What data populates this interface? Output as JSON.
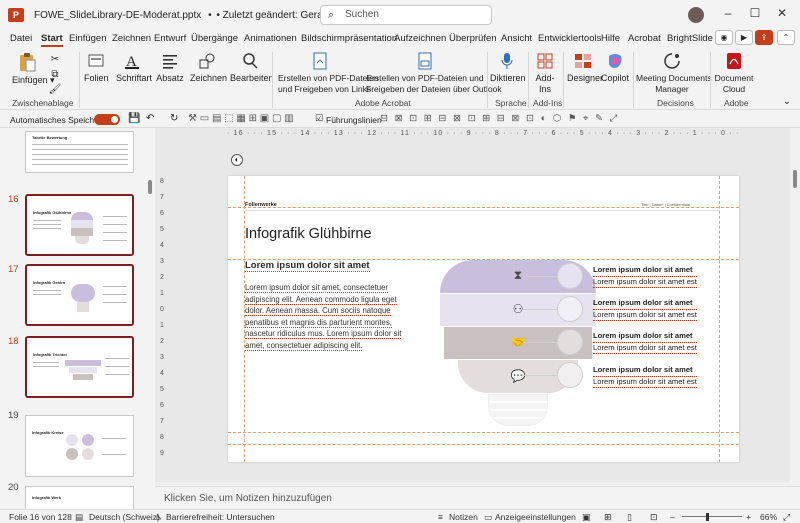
{
  "titlebar": {
    "app_badge": "P",
    "filename": "FOWE_SlideLibrary-DE-Moderat.pptx",
    "saved_status": "• Zuletzt geändert: Gerade eben",
    "search_placeholder": "Suchen"
  },
  "menu": [
    "Datei",
    "Start",
    "Einfügen",
    "Zeichnen",
    "Entwurf",
    "Übergänge",
    "Animationen",
    "Bildschirmpräsentation",
    "Aufzeichnen",
    "Überprüfen",
    "Ansicht",
    "Entwicklertools",
    "Hilfe",
    "Acrobat",
    "BrightSlide"
  ],
  "menu_active": "Start",
  "ribbon": {
    "paste": "Einfügen",
    "clipboard_group": "Zwischenablage",
    "slides": "Folien",
    "font": "Schriftart",
    "paragraph": "Absatz",
    "drawing": "Zeichnen",
    "editing": "Bearbeiten",
    "pdf_share_1": "Erstellen von PDF-Dateien",
    "pdf_share_2": "und Freigeben von Links",
    "pdf_outlook_1": "Erstellen von PDF-Dateien und",
    "pdf_outlook_2": "Freigeben der Dateien über Outlook",
    "acrobat_group": "Adobe Acrobat",
    "dictate": "Diktieren",
    "speech_group": "Sprache",
    "addins_1": "Add-",
    "addins_2": "Ins",
    "addins_group": "Add-Ins",
    "designer": "Designer",
    "copilot": "Copilot",
    "meeting_1": "Meeting Documents",
    "meeting_2": "Manager",
    "decisions_group": "Decisions",
    "doccloud_1": "Document",
    "doccloud_2": "Cloud",
    "adobe_group": "Adobe"
  },
  "qat": {
    "autosave": "Automatisches Speichern",
    "guides": "Führungslinien"
  },
  "thumbs": [
    {
      "num": "",
      "title": "Tabelle Bewertung"
    },
    {
      "num": "16",
      "title": "Infografik Glühbirne"
    },
    {
      "num": "17",
      "title": "Infografik Gehirn"
    },
    {
      "num": "18",
      "title": "Infografik Trichter"
    },
    {
      "num": "19",
      "title": "Infografik Kreise"
    },
    {
      "num": "20",
      "title": "Infografik Werk"
    }
  ],
  "ruler": {
    "h": "· 16 · · · 15 · · · 14 · · · 13 · · · 12 · · · 11 · · · 10 · · · 9 · · · 8 · · · 7 · · · 6 · · · 5 · · · 4 · · · 3 · · · 2 · · · 1 · · · 0 · · · 1 · · · 2 · · · 3 · · · 4 · · · 5 · · · 6 · · · 7 · · · 8 · · · 9 · · · 10 · · · 11 · · · 12 · · · 13 · · · 14 · · · 15 · · · 16 ·",
    "v": [
      "8",
      "7",
      "6",
      "5",
      "4",
      "3",
      "2",
      "1",
      "0",
      "1",
      "2",
      "3",
      "4",
      "5",
      "6",
      "7",
      "8",
      "9"
    ]
  },
  "slide": {
    "brand": "Folienwerke",
    "header_right": "Titel | Datum | Confidentiale",
    "title": "Infografik Glühbirne",
    "subtitle": "Lorem ipsum dolor sit amet",
    "body": "Lorem ipsum dolor sit amet, consectetuer adipiscing elit. Aenean commodo ligula eget dolor. Aenean massa. Cum sociis natoque penatibus et magnis dis parturient montes, nascetur ridiculus mus. Lorem ipsum dolor sit amet, consectetuer adipiscing elit.",
    "items": [
      {
        "head": "Lorem ipsum dolor sit amet",
        "text": "Lorem ipsum dolor sit amet est"
      },
      {
        "head": "Lorem ipsum dolor sit amet",
        "text": "Lorem ipsum dolor sit amet est"
      },
      {
        "head": "Lorem ipsum dolor sit amet",
        "text": "Lorem ipsum dolor sit amet est"
      },
      {
        "head": "Lorem ipsum dolor sit amet",
        "text": "Lorem ipsum dolor sit amet est"
      }
    ],
    "bulb_colors": [
      "#c9bfdc",
      "#e6e2ef",
      "#c9c1c0",
      "#e3dedd"
    ],
    "bulb_icons": [
      "hourglass-icon",
      "handshake-people-icon",
      "handshake-icon",
      "chat-icon"
    ]
  },
  "notes_placeholder": "Klicken Sie, um Notizen hinzuzufügen",
  "status": {
    "slide_of": "Folie 16 von 128",
    "language": "Deutsch (Schweiz)",
    "accessibility": "Barrierefreiheit: Untersuchen",
    "notes": "Notizen",
    "display_settings": "Anzeigeeinstellungen",
    "zoom": "66%"
  }
}
